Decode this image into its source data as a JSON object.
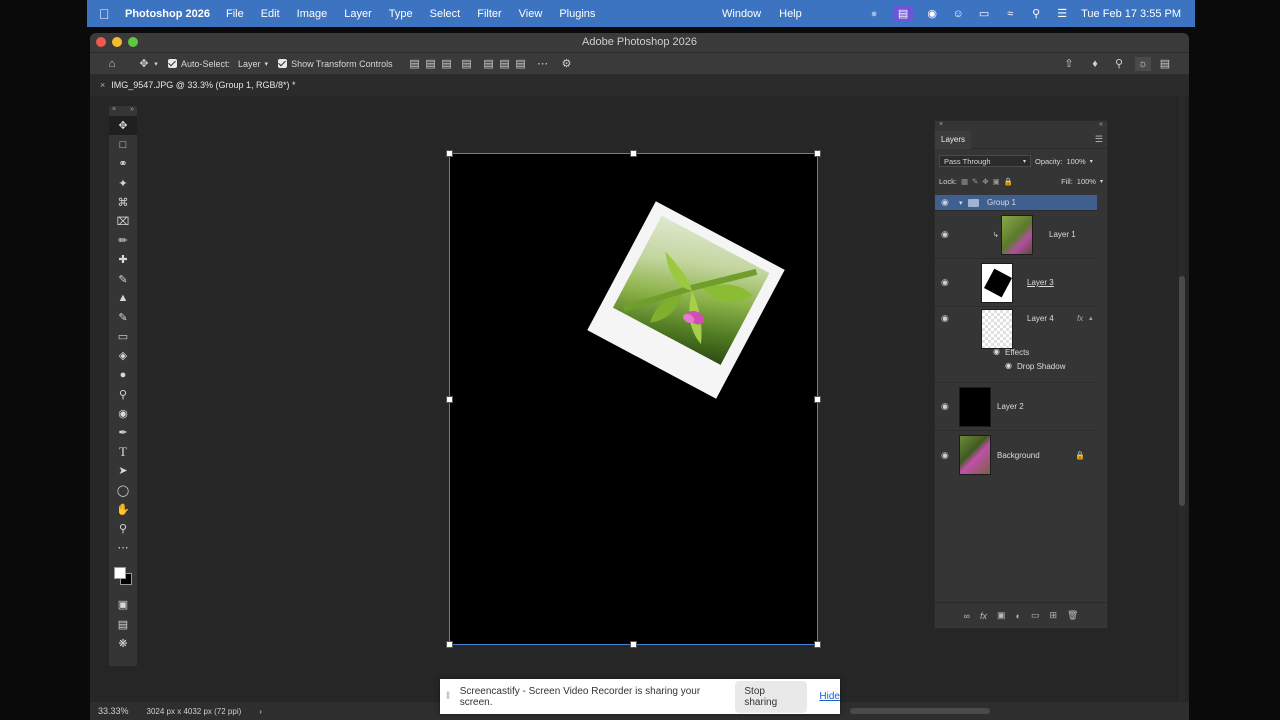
{
  "menubar": {
    "app_name": "Photoshop 2026",
    "items": [
      "File",
      "Edit",
      "Image",
      "Layer",
      "Type",
      "Select",
      "Filter",
      "View",
      "Plugins"
    ],
    "right_items": [
      "Window",
      "Help"
    ],
    "datetime": "Tue Feb 17  3:55 PM"
  },
  "window": {
    "title": "Adobe Photoshop 2026"
  },
  "options": {
    "auto_select_label": "Auto-Select:",
    "auto_select_value": "Layer",
    "transform_label": "Show Transform Controls"
  },
  "document_tab": {
    "title": "IMG_9547.JPG @ 33.3% (Group 1, RGB/8*) *"
  },
  "layers_panel": {
    "tab": "Layers",
    "blend_mode": "Pass Through",
    "opacity_label": "Opacity:",
    "opacity_value": "100%",
    "lock_label": "Lock:",
    "fill_label": "Fill:",
    "fill_value": "100%",
    "layers": [
      {
        "name": "Group 1",
        "type": "group",
        "selected": true
      },
      {
        "name": "Layer 1",
        "type": "image"
      },
      {
        "name": "Layer 3",
        "type": "shape"
      },
      {
        "name": "Layer 4",
        "type": "white",
        "fx": "fx"
      },
      {
        "name": "Effects",
        "type": "effects"
      },
      {
        "name": "Drop Shadow",
        "type": "effect"
      },
      {
        "name": "Layer 2",
        "type": "black"
      },
      {
        "name": "Background",
        "type": "image",
        "locked": true
      }
    ]
  },
  "statusbar": {
    "zoom": "33.33%",
    "doc_size": "3024 px x 4032 px (72 ppi)"
  },
  "share_bar": {
    "message": "Screencastify - Screen Video Recorder is sharing your screen.",
    "stop_label": "Stop sharing",
    "hide_label": "Hide"
  },
  "colors": {
    "menubar_bg": "#3d74c2",
    "selection_blue": "#4a82d8",
    "layer_selected": "#3e5f8f"
  }
}
